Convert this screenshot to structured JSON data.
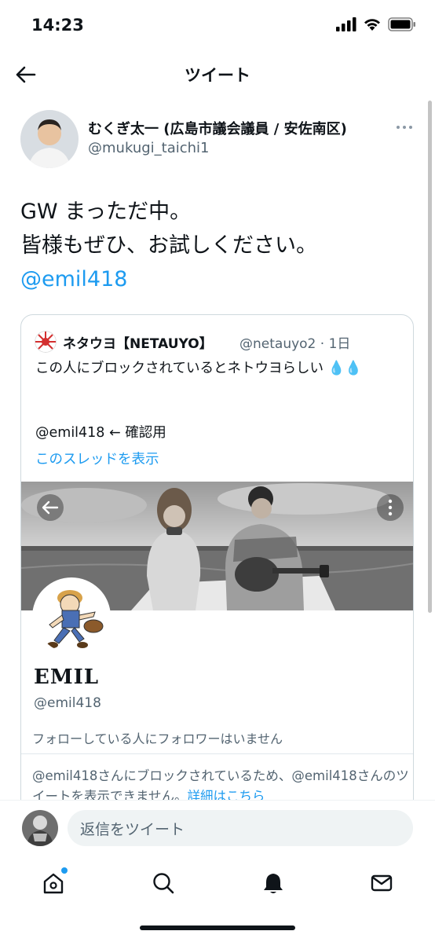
{
  "status": {
    "time": "14:23"
  },
  "header": {
    "title": "ツイート"
  },
  "tweet": {
    "author_name": "むくぎ太一 (広島市議会議員 / 安佐南区)",
    "author_handle": "@mukugi_taichi1",
    "text_line1": "GW まっただ中。",
    "text_line2": "皆様もぜひ、お試しください。",
    "mention": "@emil418"
  },
  "quote": {
    "name": "ネタウヨ【NETAUYO】",
    "meta": "@netauyo2 · 1日",
    "text": "この人にブロックされているとネトウヨらしい 💧💧",
    "mention_line": "@emil418 ← 確認用",
    "show_thread": "このスレッドを表示"
  },
  "profile_card": {
    "name": "EMIL",
    "handle": "@emil418",
    "follow_note": "フォローしている人にフォロワーはいません",
    "blocked_text": "@emil418さんにブロックされているため、@emil418さんのツイートを表示できません。",
    "blocked_link": "詳細はこちら"
  },
  "reply": {
    "placeholder": "返信をツイート"
  },
  "tabs": [
    "home-icon",
    "search-icon",
    "notifications-icon",
    "messages-icon"
  ],
  "colors": {
    "accent": "#1d9bf0",
    "text": "#0f1419",
    "muted": "#536471"
  }
}
